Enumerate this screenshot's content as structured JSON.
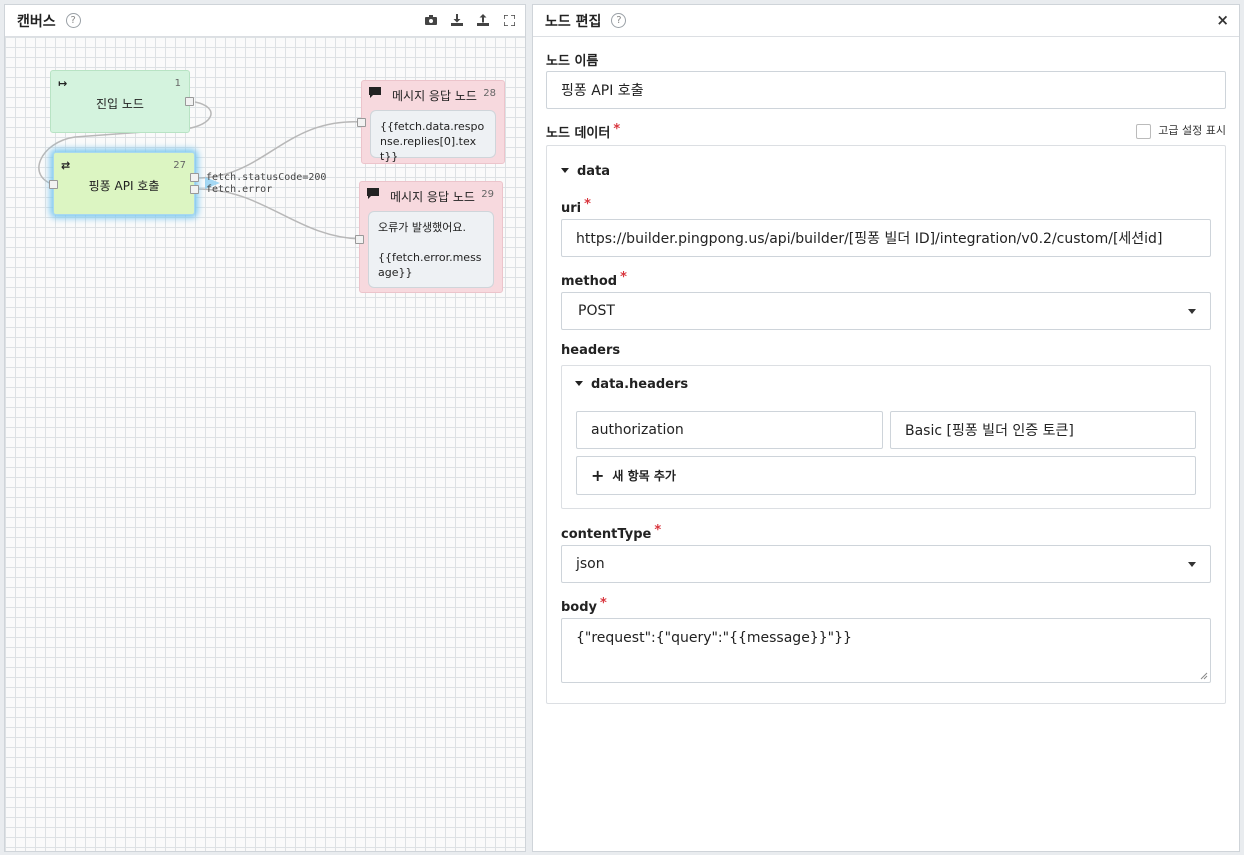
{
  "left_panel": {
    "title": "캔버스",
    "help": "?",
    "toolbar": [
      "camera-icon",
      "download-icon",
      "upload-icon",
      "fullscreen-icon"
    ]
  },
  "nodes": {
    "entry": {
      "title": "진입 노드",
      "num": "1",
      "icon": "↦"
    },
    "api": {
      "title": "핑퐁 API 호출",
      "num": "27",
      "icon": "⇄",
      "ports": [
        "fetch.statusCode=200",
        "fetch.error"
      ]
    },
    "msg1": {
      "title": "메시지 응답 노드",
      "num": "28",
      "text": "{{fetch.data.response.replies[0].text}}"
    },
    "msg2": {
      "title": "메시지 응답 노드",
      "num": "29",
      "text": "오류가 발생했어요.\n\n{{fetch.error.message}}"
    }
  },
  "right_panel": {
    "title": "노드 편집",
    "help": "?",
    "close": "×",
    "node_name_label": "노드 이름",
    "node_name_value": "핑퐁 API 호출",
    "node_data_label": "노드 데이터",
    "advanced_label": "고급 설정 표시",
    "data_label": "data",
    "uri_label": "uri",
    "uri_value": "https://builder.pingpong.us/api/builder/[핑퐁 빌더 ID]/integration/v0.2/custom/[세션id]",
    "method_label": "method",
    "method_value": "POST",
    "headers_label": "headers",
    "data_headers_label": "data.headers",
    "header_key": "authorization",
    "header_value": "Basic [핑퐁 빌더 인증 토큰]",
    "add_item_label": "새 항목 추가",
    "content_type_label": "contentType",
    "content_type_value": "json",
    "body_label": "body",
    "body_value": "{\"request\":{\"query\":\"{{message}}\"}}"
  }
}
